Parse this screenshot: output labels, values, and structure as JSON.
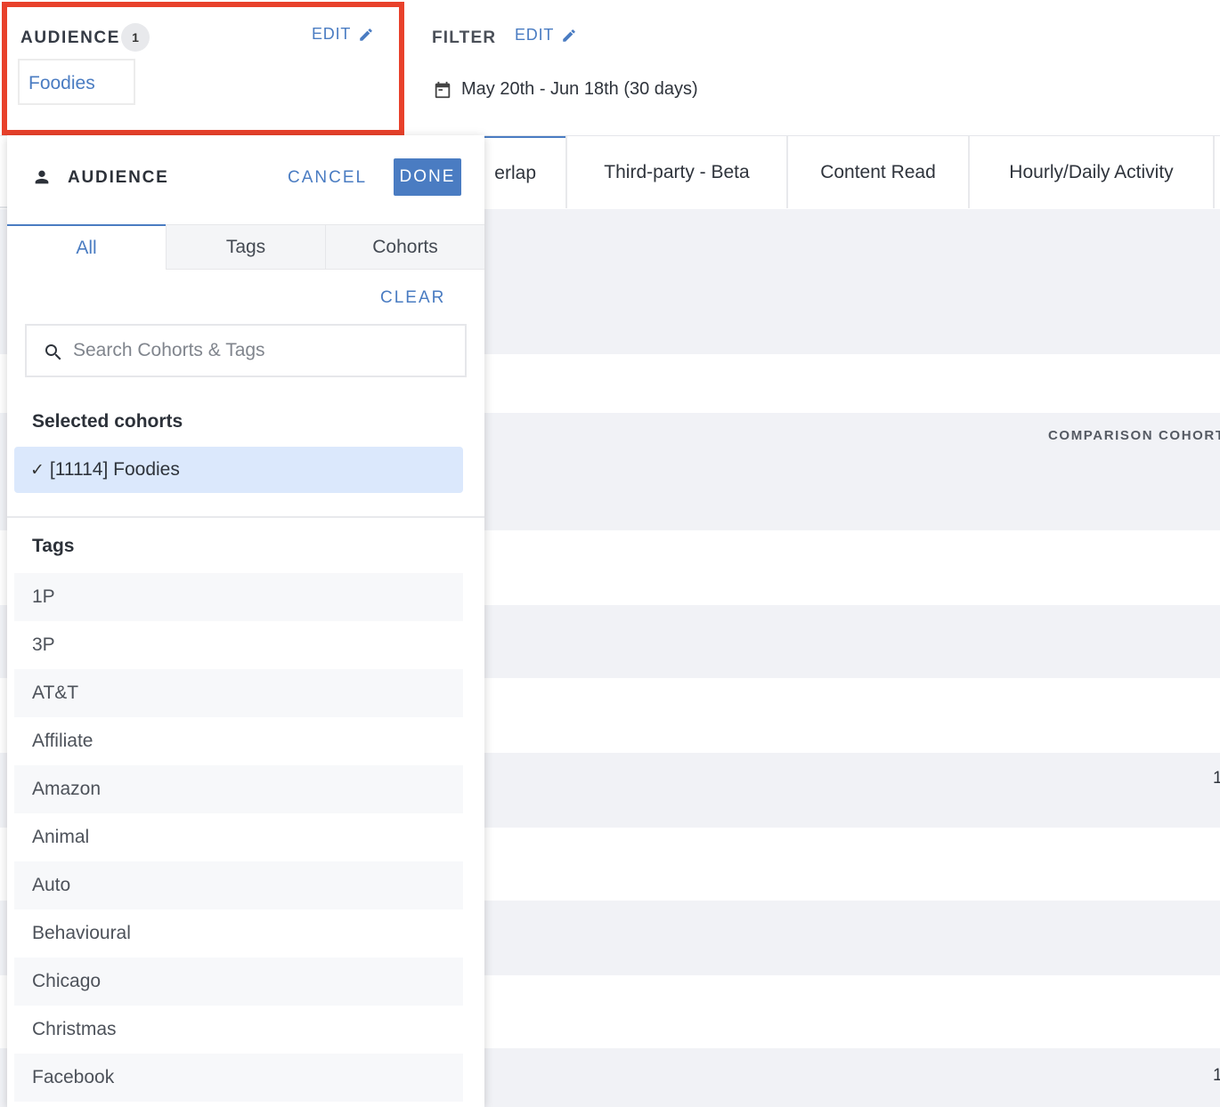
{
  "header": {
    "audience": {
      "title": "AUDIENCE",
      "count": "1",
      "edit_label": "EDIT",
      "selected_chip": "Foodies"
    },
    "filter": {
      "title": "FILTER",
      "edit_label": "EDIT",
      "date_range": "May 20th - Jun 18th (30 days)"
    }
  },
  "tabs": [
    {
      "label": "erlap",
      "active": true
    },
    {
      "label": "Third-party - Beta"
    },
    {
      "label": "Content Read"
    },
    {
      "label": "Hourly/Daily Activity"
    }
  ],
  "table": {
    "column_label": "COMPARISON COHORT",
    "edge_values": [
      "1",
      "1"
    ]
  },
  "panel": {
    "title": "AUDIENCE",
    "cancel_label": "CANCEL",
    "done_label": "DONE",
    "tabs": [
      "All",
      "Tags",
      "Cohorts"
    ],
    "active_tab": "All",
    "clear_label": "CLEAR",
    "search": {
      "placeholder": "Search Cohorts & Tags",
      "value": ""
    },
    "selected_heading": "Selected cohorts",
    "selected_cohorts": [
      "[11114] Foodies"
    ],
    "tags_heading": "Tags",
    "tags": [
      "1P",
      "3P",
      "AT&T",
      "Affiliate",
      "Amazon",
      "Animal",
      "Auto",
      "Behavioural",
      "Chicago",
      "Christmas",
      "Facebook"
    ]
  },
  "colors": {
    "accent": "#4a7cc2",
    "highlight_border": "#e8412b",
    "selected_bg": "#dbe8fc",
    "stripe": "#f1f2f6"
  },
  "icons": [
    "pencil-icon",
    "calendar-icon",
    "person-icon",
    "search-icon",
    "check-icon"
  ]
}
